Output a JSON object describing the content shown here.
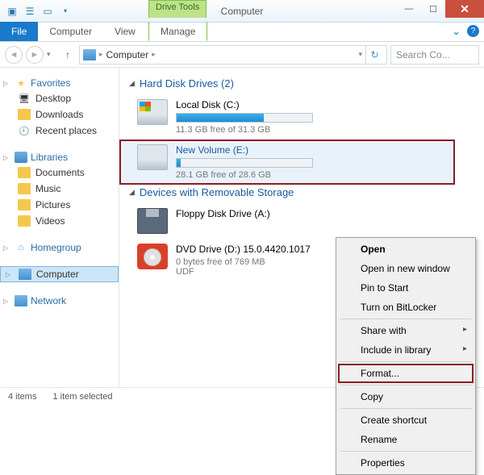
{
  "window": {
    "title": "Computer",
    "drive_tools": "Drive Tools"
  },
  "ribbon": {
    "file": "File",
    "computer": "Computer",
    "view": "View",
    "manage": "Manage"
  },
  "addr": {
    "crumb": "Computer",
    "search_placeholder": "Search Co..."
  },
  "nav": {
    "favorites": "Favorites",
    "fav_items": [
      "Desktop",
      "Downloads",
      "Recent places"
    ],
    "libraries": "Libraries",
    "lib_items": [
      "Documents",
      "Music",
      "Pictures",
      "Videos"
    ],
    "homegroup": "Homegroup",
    "computer": "Computer",
    "network": "Network"
  },
  "sections": {
    "hdd": "Hard Disk Drives (2)",
    "removable": "Devices with Removable Storage"
  },
  "drives": {
    "c": {
      "name": "Local Disk (C:)",
      "free": "11.3 GB free of 31.3 GB",
      "pct": 64
    },
    "e": {
      "name": "New Volume (E:)",
      "free": "28.1 GB free of 28.6 GB",
      "pct": 3
    },
    "floppy": {
      "name": "Floppy Disk Drive (A:)"
    },
    "dvd": {
      "name": "DVD Drive (D:) 15.0.4420.1017",
      "free": "0 bytes free of 769 MB",
      "fs": "UDF"
    }
  },
  "ctx": {
    "open": "Open",
    "open_new": "Open in new window",
    "pin": "Pin to Start",
    "bitlocker": "Turn on BitLocker",
    "share": "Share with",
    "include": "Include in library",
    "format": "Format...",
    "copy": "Copy",
    "shortcut": "Create shortcut",
    "rename": "Rename",
    "properties": "Properties"
  },
  "status": {
    "items": "4 items",
    "selected": "1 item selected"
  }
}
